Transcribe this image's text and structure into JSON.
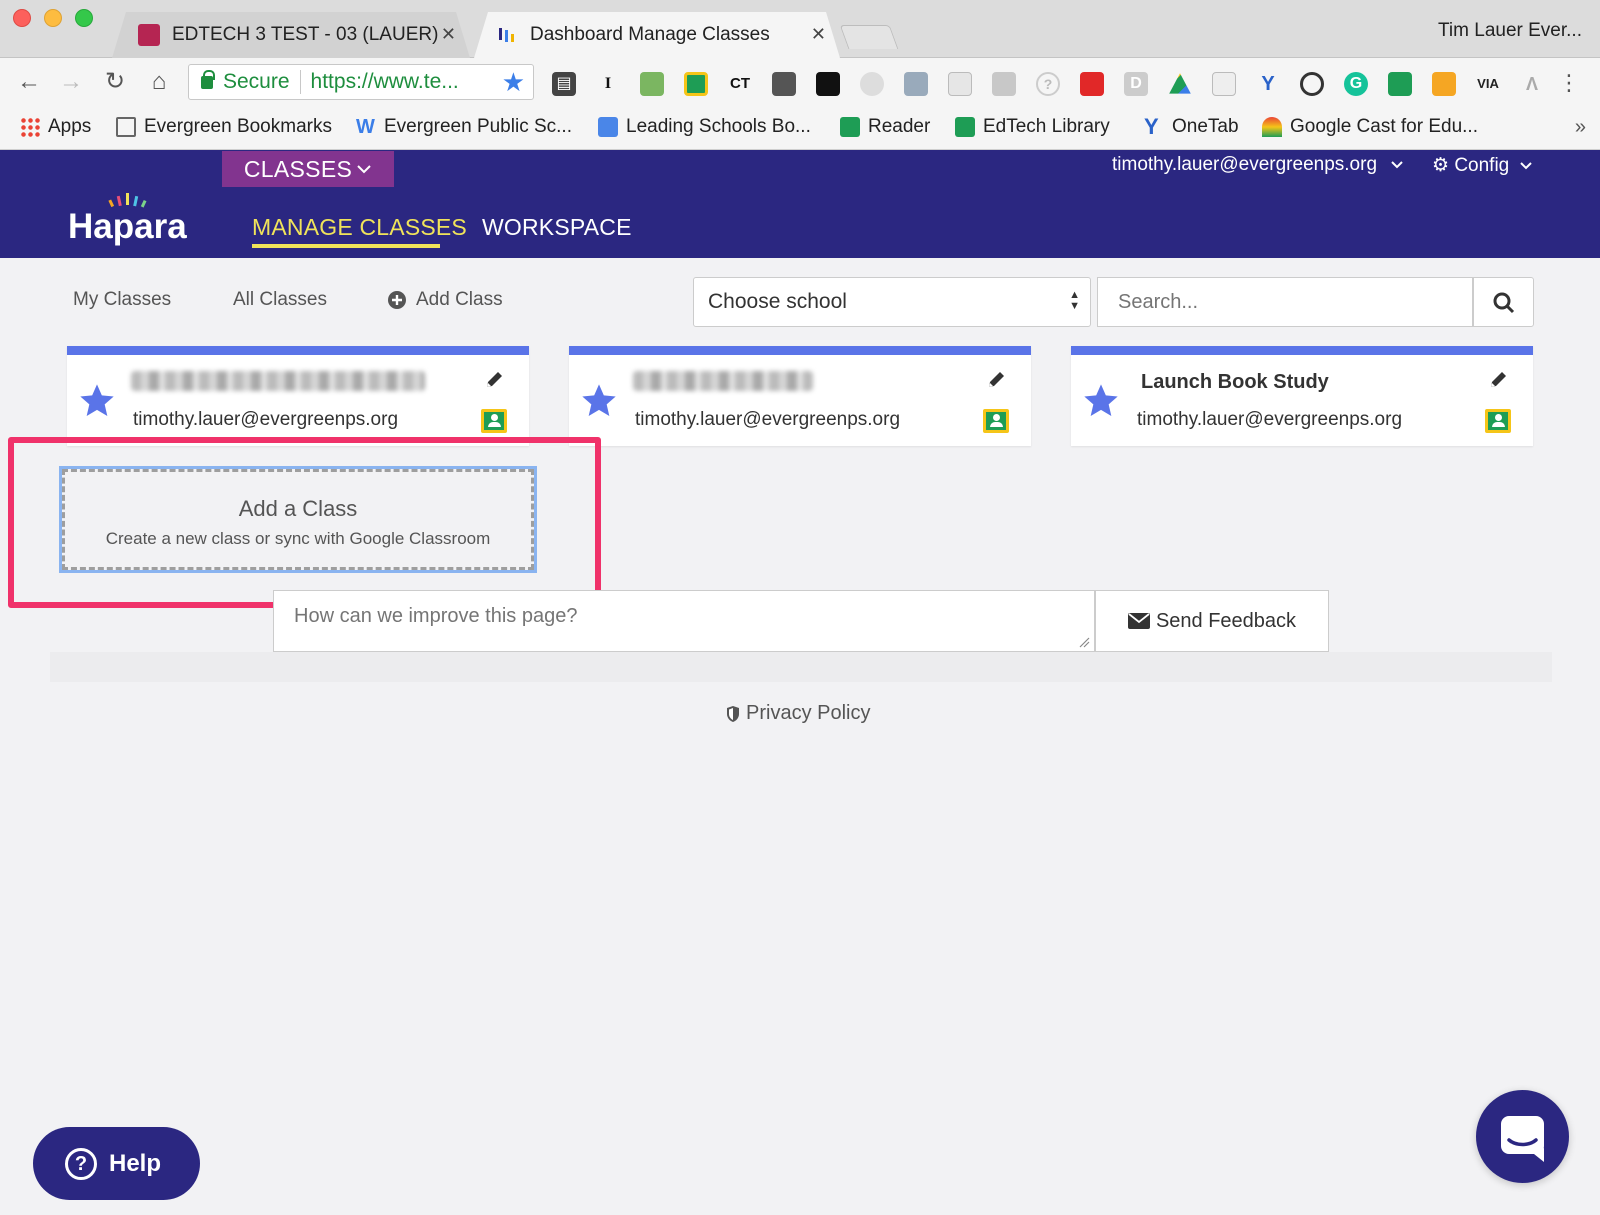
{
  "browser": {
    "tabs": [
      {
        "title": "EDTECH 3 TEST - 03 (LAUER)",
        "active": false
      },
      {
        "title": "Dashboard Manage Classes",
        "active": true
      }
    ],
    "profile_name": "Tim Lauer Ever...",
    "omnibox": {
      "secure_label": "Secure",
      "url": "https://www.te..."
    },
    "extensions": [
      "film-icon",
      "I",
      "puzzle-icon",
      "classroom-icon",
      "CT",
      "bulb-icon",
      "cloud-icon",
      "link-icon",
      "drive-badge-icon",
      "window-icon",
      "brush-icon",
      "help-circle-icon",
      "flipboard-icon",
      "D",
      "drive-icon",
      "paper-plane-icon",
      "onetab-icon",
      "target-icon",
      "G",
      "cast-icon",
      "wifi-icon",
      "VIA",
      "A"
    ],
    "bookmarks": [
      {
        "label": "Apps",
        "icon": "apps-grid-icon"
      },
      {
        "label": "Evergreen Bookmarks",
        "icon": "folder-icon"
      },
      {
        "label": "Evergreen Public Sc...",
        "icon": "weebly-icon"
      },
      {
        "label": "Leading Schools Bo...",
        "icon": "docs-icon"
      },
      {
        "label": "Reader",
        "icon": "eps-icon"
      },
      {
        "label": "EdTech Library",
        "icon": "eps-icon"
      },
      {
        "label": "OneTab",
        "icon": "onetab-icon"
      },
      {
        "label": "Google Cast for Edu...",
        "icon": "cast-edu-icon"
      }
    ]
  },
  "header": {
    "section_tab": "CLASSES",
    "logo": "Hapara",
    "nav": {
      "manage": "MANAGE CLASSES",
      "workspace": "WORKSPACE"
    },
    "user_email": "timothy.lauer@evergreenps.org",
    "config_label": "Config"
  },
  "subnav": {
    "my_classes": "My Classes",
    "all_classes": "All Classes",
    "add_class": "Add Class"
  },
  "school_select": {
    "selected": "Choose school"
  },
  "search": {
    "placeholder": "Search..."
  },
  "classes": [
    {
      "title": "",
      "owner": "timothy.lauer@evergreenps.org",
      "title_redacted": true
    },
    {
      "title": "",
      "owner": "timothy.lauer@evergreenps.org",
      "title_redacted": true
    },
    {
      "title": "Launch Book Study",
      "owner": "timothy.lauer@evergreenps.org",
      "title_redacted": false
    }
  ],
  "add_class_card": {
    "title": "Add a Class",
    "subtitle": "Create a new class or sync with Google Classroom"
  },
  "feedback": {
    "placeholder": "How can we improve this page?",
    "button": "Send Feedback"
  },
  "footer": {
    "privacy": "Privacy Policy"
  },
  "help": {
    "label": "Help"
  },
  "colors": {
    "brand_navy": "#2b2781",
    "classes_purple": "#82348f",
    "nav_active": "#f0e35a",
    "card_accent": "#5a74e8",
    "highlight": "#f0326a"
  }
}
